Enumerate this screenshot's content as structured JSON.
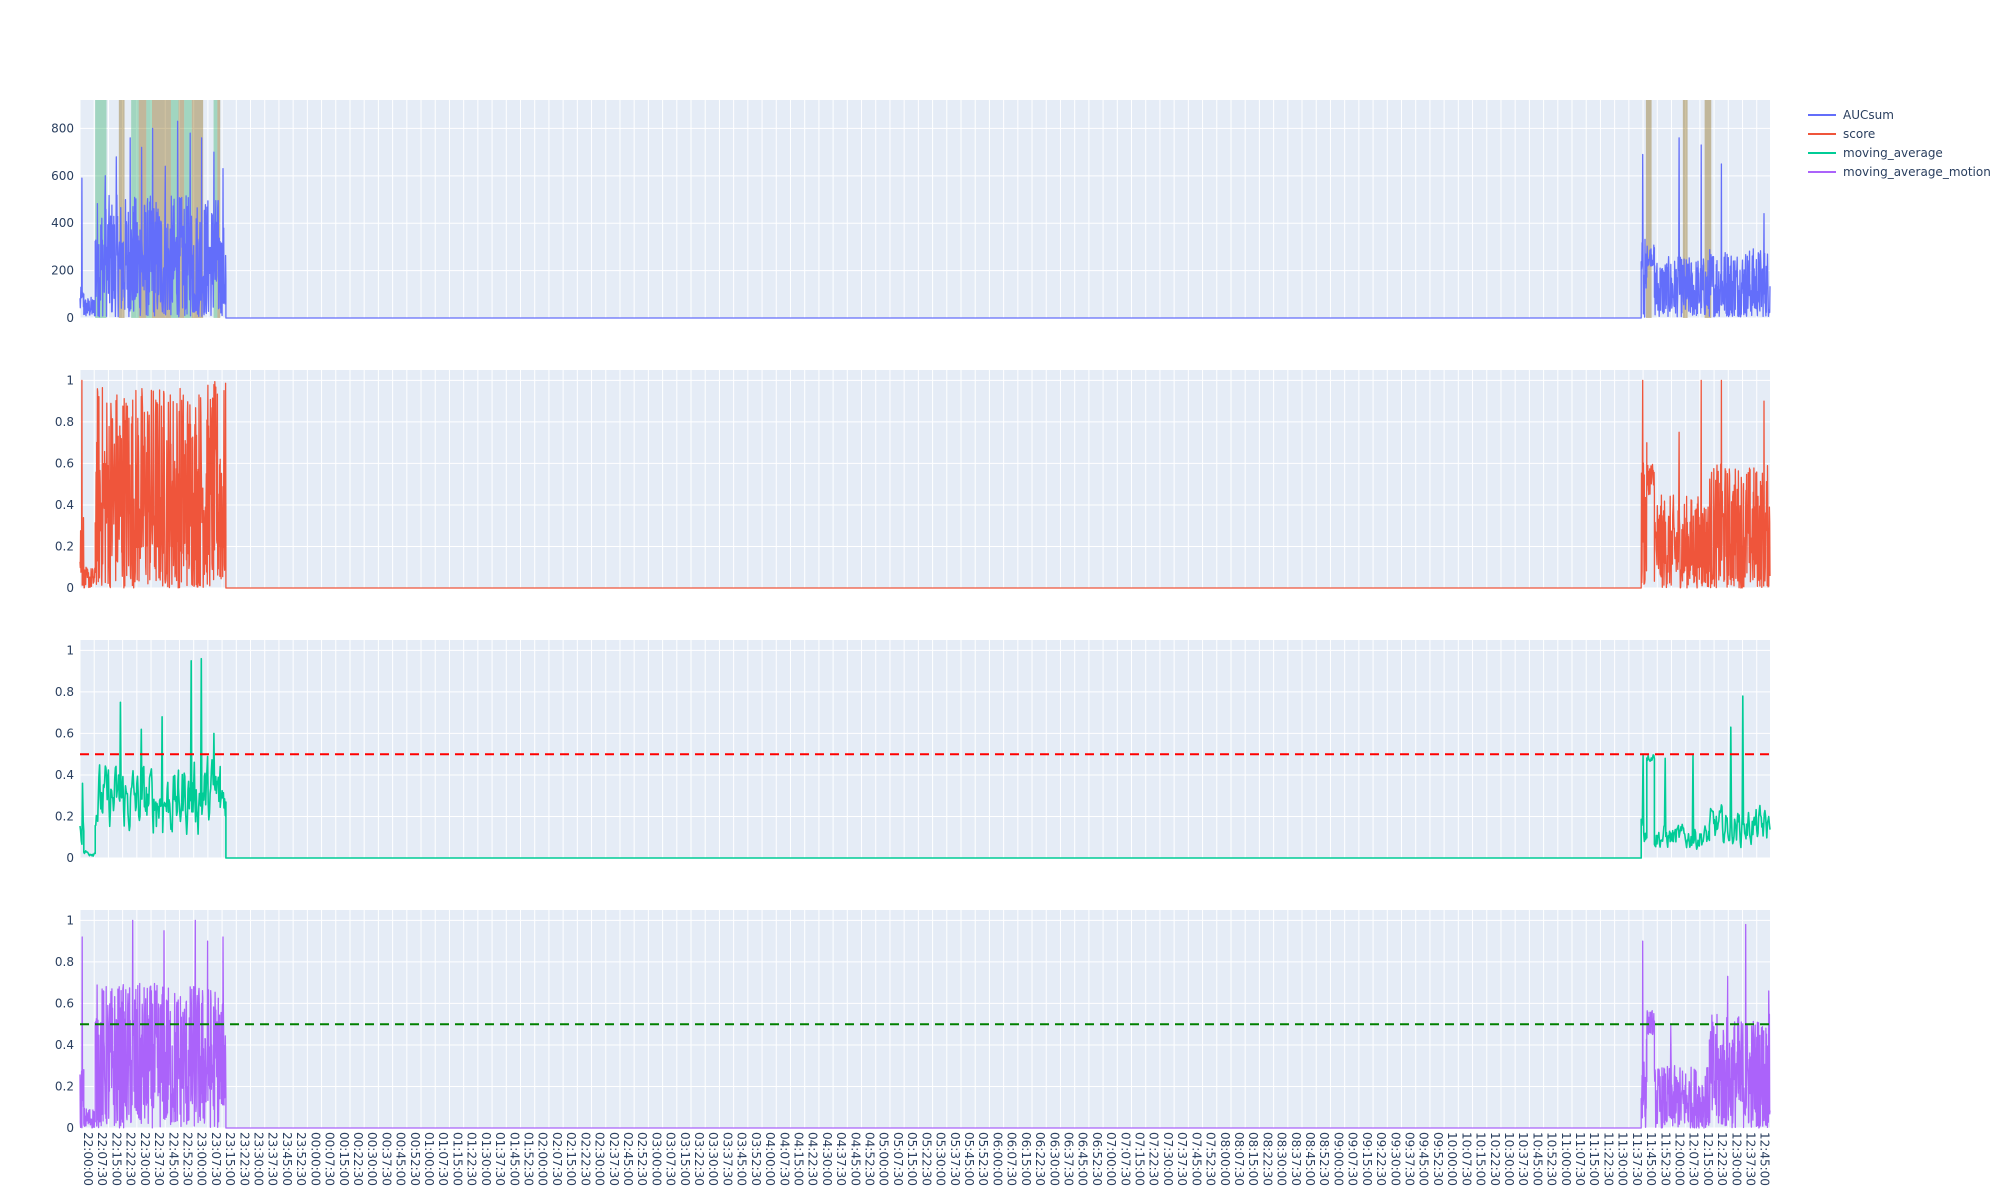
{
  "chart_data": {
    "type": "line",
    "title": "",
    "legend": {
      "placement": "top-right",
      "entries": [
        "AUCsum",
        "score",
        "moving_average",
        "moving_average_motion"
      ]
    },
    "colors": {
      "AUCsum": "#636efa",
      "score": "#ef553b",
      "moving_average": "#00cc96",
      "moving_average_motion": "#ab63fa",
      "threshold_red": "#ff0000",
      "threshold_green": "#008000",
      "band_green": "#3cb371",
      "band_brown": "#8b6914",
      "plot_bg": "#e5ecf6",
      "grid": "#ffffff"
    },
    "x_axis": {
      "start": "22:00:00",
      "end": "12:52:00",
      "tick_interval": "00:07:30",
      "tick_labels": [
        "22:00:00",
        "22:07:30",
        "22:15:00",
        "22:22:30",
        "22:30:00",
        "22:37:30",
        "22:45:00",
        "22:52:30",
        "23:00:00",
        "23:07:30",
        "23:15:00",
        "23:22:30",
        "23:30:00",
        "23:37:30",
        "23:45:00",
        "23:52:30",
        "00:00:00",
        "00:07:30",
        "00:15:00",
        "00:22:30",
        "00:30:00",
        "00:37:30",
        "00:45:00",
        "00:52:30",
        "01:00:00",
        "01:07:30",
        "01:15:00",
        "01:22:30",
        "01:30:00",
        "01:37:30",
        "01:45:00",
        "01:52:30",
        "02:00:00",
        "02:07:30",
        "02:15:00",
        "02:22:30",
        "02:30:00",
        "02:37:30",
        "02:45:00",
        "02:52:30",
        "03:00:00",
        "03:07:30",
        "03:15:00",
        "03:22:30",
        "03:30:00",
        "03:37:30",
        "03:45:00",
        "03:52:30",
        "04:00:00",
        "04:07:30",
        "04:15:00",
        "04:22:30",
        "04:30:00",
        "04:37:30",
        "04:45:00",
        "04:52:30",
        "05:00:00",
        "05:07:30",
        "05:15:00",
        "05:22:30",
        "05:30:00",
        "05:37:30",
        "05:45:00",
        "05:52:30",
        "06:00:00",
        "06:07:30",
        "06:15:00",
        "06:22:30",
        "06:30:00",
        "06:37:30",
        "06:45:00",
        "06:52:30",
        "07:00:00",
        "07:07:30",
        "07:15:00",
        "07:22:30",
        "07:30:00",
        "07:37:30",
        "07:45:00",
        "07:52:30",
        "08:00:00",
        "08:07:30",
        "08:15:00",
        "08:22:30",
        "08:30:00",
        "08:37:30",
        "08:45:00",
        "08:52:30",
        "09:00:00",
        "09:07:30",
        "09:15:00",
        "09:22:30",
        "09:30:00",
        "09:37:30",
        "09:45:00",
        "09:52:30",
        "10:00:00",
        "10:07:30",
        "10:15:00",
        "10:22:30",
        "10:30:00",
        "10:37:30",
        "10:45:00",
        "10:52:30",
        "11:00:00",
        "11:07:30",
        "11:15:00",
        "11:22:30",
        "11:30:00",
        "11:37:30",
        "11:45:00",
        "11:52:30",
        "12:00:00",
        "12:07:30",
        "12:15:00",
        "12:22:30",
        "12:30:00",
        "12:37:30",
        "12:45:00"
      ]
    },
    "panels": [
      {
        "series": "AUCsum",
        "ylim": [
          0,
          920
        ],
        "yticks": [
          0,
          200,
          400,
          600,
          800
        ],
        "ytick_labels": [
          "0",
          "200",
          "400",
          "600",
          "800"
        ],
        "bands": [
          {
            "start": "22:08:00",
            "end": "22:14:00",
            "kind": "green"
          },
          {
            "start": "22:20:30",
            "end": "22:23:30",
            "kind": "brown"
          },
          {
            "start": "22:27:00",
            "end": "22:31:00",
            "kind": "green"
          },
          {
            "start": "22:31:00",
            "end": "22:35:00",
            "kind": "brown"
          },
          {
            "start": "22:35:00",
            "end": "22:38:00",
            "kind": "green"
          },
          {
            "start": "22:38:00",
            "end": "22:48:00",
            "kind": "brown"
          },
          {
            "start": "22:48:00",
            "end": "22:52:00",
            "kind": "green"
          },
          {
            "start": "22:52:00",
            "end": "22:55:00",
            "kind": "brown"
          },
          {
            "start": "22:55:00",
            "end": "22:59:00",
            "kind": "green"
          },
          {
            "start": "22:59:00",
            "end": "23:05:00",
            "kind": "brown"
          },
          {
            "start": "23:10:30",
            "end": "23:12:30",
            "kind": "green"
          },
          {
            "start": "23:12:30",
            "end": "23:14:00",
            "kind": "brown"
          },
          {
            "start": "11:46:30",
            "end": "11:49:30",
            "kind": "brown"
          },
          {
            "start": "12:06:00",
            "end": "12:08:30",
            "kind": "brown"
          },
          {
            "start": "12:17:30",
            "end": "12:21:00",
            "kind": "brown"
          }
        ],
        "segments": [
          {
            "start": "22:00:00",
            "end": "22:02:00",
            "min": 20,
            "max": 130,
            "spikes": [
              [
                0.5,
                590
              ]
            ]
          },
          {
            "start": "22:02:00",
            "end": "22:08:00",
            "min": 5,
            "max": 90,
            "spikes": []
          },
          {
            "start": "22:08:00",
            "end": "23:14:00",
            "min": 5,
            "max": 520,
            "spikes": [
              [
                0.08,
                600
              ],
              [
                0.17,
                680
              ],
              [
                0.28,
                760
              ],
              [
                0.37,
                720
              ],
              [
                0.46,
                800
              ],
              [
                0.56,
                640
              ],
              [
                0.66,
                830
              ],
              [
                0.76,
                780
              ],
              [
                0.85,
                760
              ],
              [
                0.95,
                700
              ]
            ]
          },
          {
            "start": "23:14:00",
            "end": "23:17:00",
            "min": 10,
            "max": 400,
            "spikes": [
              [
                0.5,
                630
              ]
            ]
          },
          {
            "start": "23:17:00",
            "end": "11:44:00",
            "min": 0,
            "max": 0,
            "spikes": []
          },
          {
            "start": "11:44:00",
            "end": "11:47:00",
            "min": 0,
            "max": 350,
            "spikes": [
              [
                0.3,
                690
              ]
            ]
          },
          {
            "start": "11:47:00",
            "end": "11:51:00",
            "min": 220,
            "max": 310,
            "spikes": []
          },
          {
            "start": "11:51:00",
            "end": "12:20:00",
            "min": 5,
            "max": 260,
            "spikes": [
              [
                0.45,
                760
              ],
              [
                0.85,
                730
              ]
            ]
          },
          {
            "start": "12:20:00",
            "end": "12:52:00",
            "min": 5,
            "max": 300,
            "spikes": [
              [
                0.2,
                650
              ],
              [
                0.9,
                440
              ]
            ]
          }
        ]
      },
      {
        "series": "score",
        "ylim": [
          0,
          1.05
        ],
        "yticks": [
          0,
          0.2,
          0.4,
          0.6,
          0.8,
          1
        ],
        "ytick_labels": [
          "0",
          "0.2",
          "0.4",
          "0.6",
          "0.8",
          "1"
        ],
        "bands": [],
        "segments": [
          {
            "start": "22:00:00",
            "end": "22:02:00",
            "min": 0,
            "max": 0.4,
            "spikes": [
              [
                0.5,
                1
              ]
            ]
          },
          {
            "start": "22:02:00",
            "end": "22:08:00",
            "min": 0,
            "max": 0.1,
            "spikes": []
          },
          {
            "start": "22:08:00",
            "end": "23:14:00",
            "min": 0,
            "max": 1,
            "spikes": []
          },
          {
            "start": "23:14:00",
            "end": "23:17:00",
            "min": 0,
            "max": 1,
            "spikes": []
          },
          {
            "start": "23:17:00",
            "end": "11:44:00",
            "min": 0,
            "max": 0,
            "spikes": []
          },
          {
            "start": "11:44:00",
            "end": "11:47:00",
            "min": 0,
            "max": 0.7,
            "spikes": [
              [
                0.3,
                1
              ]
            ]
          },
          {
            "start": "11:47:00",
            "end": "11:51:00",
            "min": 0.45,
            "max": 0.62,
            "spikes": []
          },
          {
            "start": "11:51:00",
            "end": "12:20:00",
            "min": 0,
            "max": 0.45,
            "spikes": [
              [
                0.45,
                0.75
              ],
              [
                0.85,
                1
              ]
            ]
          },
          {
            "start": "12:20:00",
            "end": "12:52:00",
            "min": 0,
            "max": 0.6,
            "spikes": [
              [
                0.2,
                1
              ],
              [
                0.9,
                0.9
              ]
            ]
          }
        ]
      },
      {
        "series": "moving_average",
        "ylim": [
          0,
          1.05
        ],
        "yticks": [
          0,
          0.2,
          0.4,
          0.6,
          0.8,
          1
        ],
        "ytick_labels": [
          "0",
          "0.2",
          "0.4",
          "0.6",
          "0.8",
          "1"
        ],
        "threshold": {
          "value": 0.5,
          "color_key": "threshold_red"
        },
        "bands": [],
        "smooth": true,
        "segments": [
          {
            "start": "22:00:00",
            "end": "22:02:00",
            "min": 0.0,
            "max": 0.3,
            "spikes": [
              [
                0.6,
                0.36
              ]
            ]
          },
          {
            "start": "22:02:00",
            "end": "22:08:00",
            "min": 0,
            "max": 0.05,
            "spikes": []
          },
          {
            "start": "22:08:00",
            "end": "22:52:00",
            "min": 0.0,
            "max": 0.55,
            "spikes": [
              [
                0.3,
                0.75
              ],
              [
                0.55,
                0.62
              ],
              [
                0.8,
                0.68
              ]
            ]
          },
          {
            "start": "22:52:00",
            "end": "23:14:00",
            "min": 0.0,
            "max": 0.6,
            "spikes": [
              [
                0.3,
                0.95
              ],
              [
                0.55,
                0.96
              ],
              [
                0.85,
                0.6
              ]
            ]
          },
          {
            "start": "23:14:00",
            "end": "23:17:00",
            "min": 0.1,
            "max": 0.5,
            "spikes": [
              [
                0.5,
                0.81
              ]
            ]
          },
          {
            "start": "23:17:00",
            "end": "11:44:00",
            "min": 0,
            "max": 0,
            "spikes": []
          },
          {
            "start": "11:44:00",
            "end": "11:47:00",
            "min": 0,
            "max": 0.3,
            "spikes": [
              [
                0.3,
                0.5
              ]
            ]
          },
          {
            "start": "11:47:00",
            "end": "11:51:00",
            "min": 0.45,
            "max": 0.53,
            "spikes": []
          },
          {
            "start": "11:51:00",
            "end": "12:20:00",
            "min": 0,
            "max": 0.2,
            "spikes": [
              [
                0.2,
                0.48
              ],
              [
                0.7,
                0.5
              ]
            ]
          },
          {
            "start": "12:20:00",
            "end": "12:52:00",
            "min": 0,
            "max": 0.3,
            "spikes": [
              [
                0.35,
                0.63
              ],
              [
                0.55,
                0.78
              ],
              [
                0.98,
                0.2
              ]
            ]
          }
        ]
      },
      {
        "series": "moving_average_motion",
        "ylim": [
          0,
          1.05
        ],
        "yticks": [
          0,
          0.2,
          0.4,
          0.6,
          0.8,
          1
        ],
        "ytick_labels": [
          "0",
          "0.2",
          "0.4",
          "0.6",
          "0.8",
          "1"
        ],
        "threshold": {
          "value": 0.5,
          "color_key": "threshold_green"
        },
        "bands": [],
        "segments": [
          {
            "start": "22:00:00",
            "end": "22:02:00",
            "min": 0,
            "max": 0.3,
            "spikes": [
              [
                0.6,
                0.92
              ]
            ]
          },
          {
            "start": "22:02:00",
            "end": "22:08:00",
            "min": 0,
            "max": 0.1,
            "spikes": []
          },
          {
            "start": "22:08:00",
            "end": "23:14:00",
            "min": 0,
            "max": 0.7,
            "spikes": [
              [
                0.3,
                1
              ],
              [
                0.55,
                0.95
              ],
              [
                0.8,
                1
              ],
              [
                0.9,
                0.9
              ]
            ]
          },
          {
            "start": "23:14:00",
            "end": "23:17:00",
            "min": 0.1,
            "max": 0.6,
            "spikes": [
              [
                0.5,
                0.92
              ]
            ]
          },
          {
            "start": "23:17:00",
            "end": "11:44:00",
            "min": 0,
            "max": 0,
            "spikes": []
          },
          {
            "start": "11:44:00",
            "end": "11:47:00",
            "min": 0,
            "max": 0.5,
            "spikes": [
              [
                0.3,
                0.9
              ]
            ]
          },
          {
            "start": "11:47:00",
            "end": "11:51:00",
            "min": 0.45,
            "max": 0.57,
            "spikes": []
          },
          {
            "start": "11:51:00",
            "end": "12:20:00",
            "min": 0,
            "max": 0.3,
            "spikes": [
              [
                0.3,
                0.5
              ],
              [
                0.75,
                0.5
              ]
            ]
          },
          {
            "start": "12:20:00",
            "end": "12:52:00",
            "min": 0,
            "max": 0.55,
            "spikes": [
              [
                0.3,
                0.73
              ],
              [
                0.6,
                0.98
              ],
              [
                0.98,
                0.66
              ]
            ]
          }
        ]
      }
    ]
  }
}
